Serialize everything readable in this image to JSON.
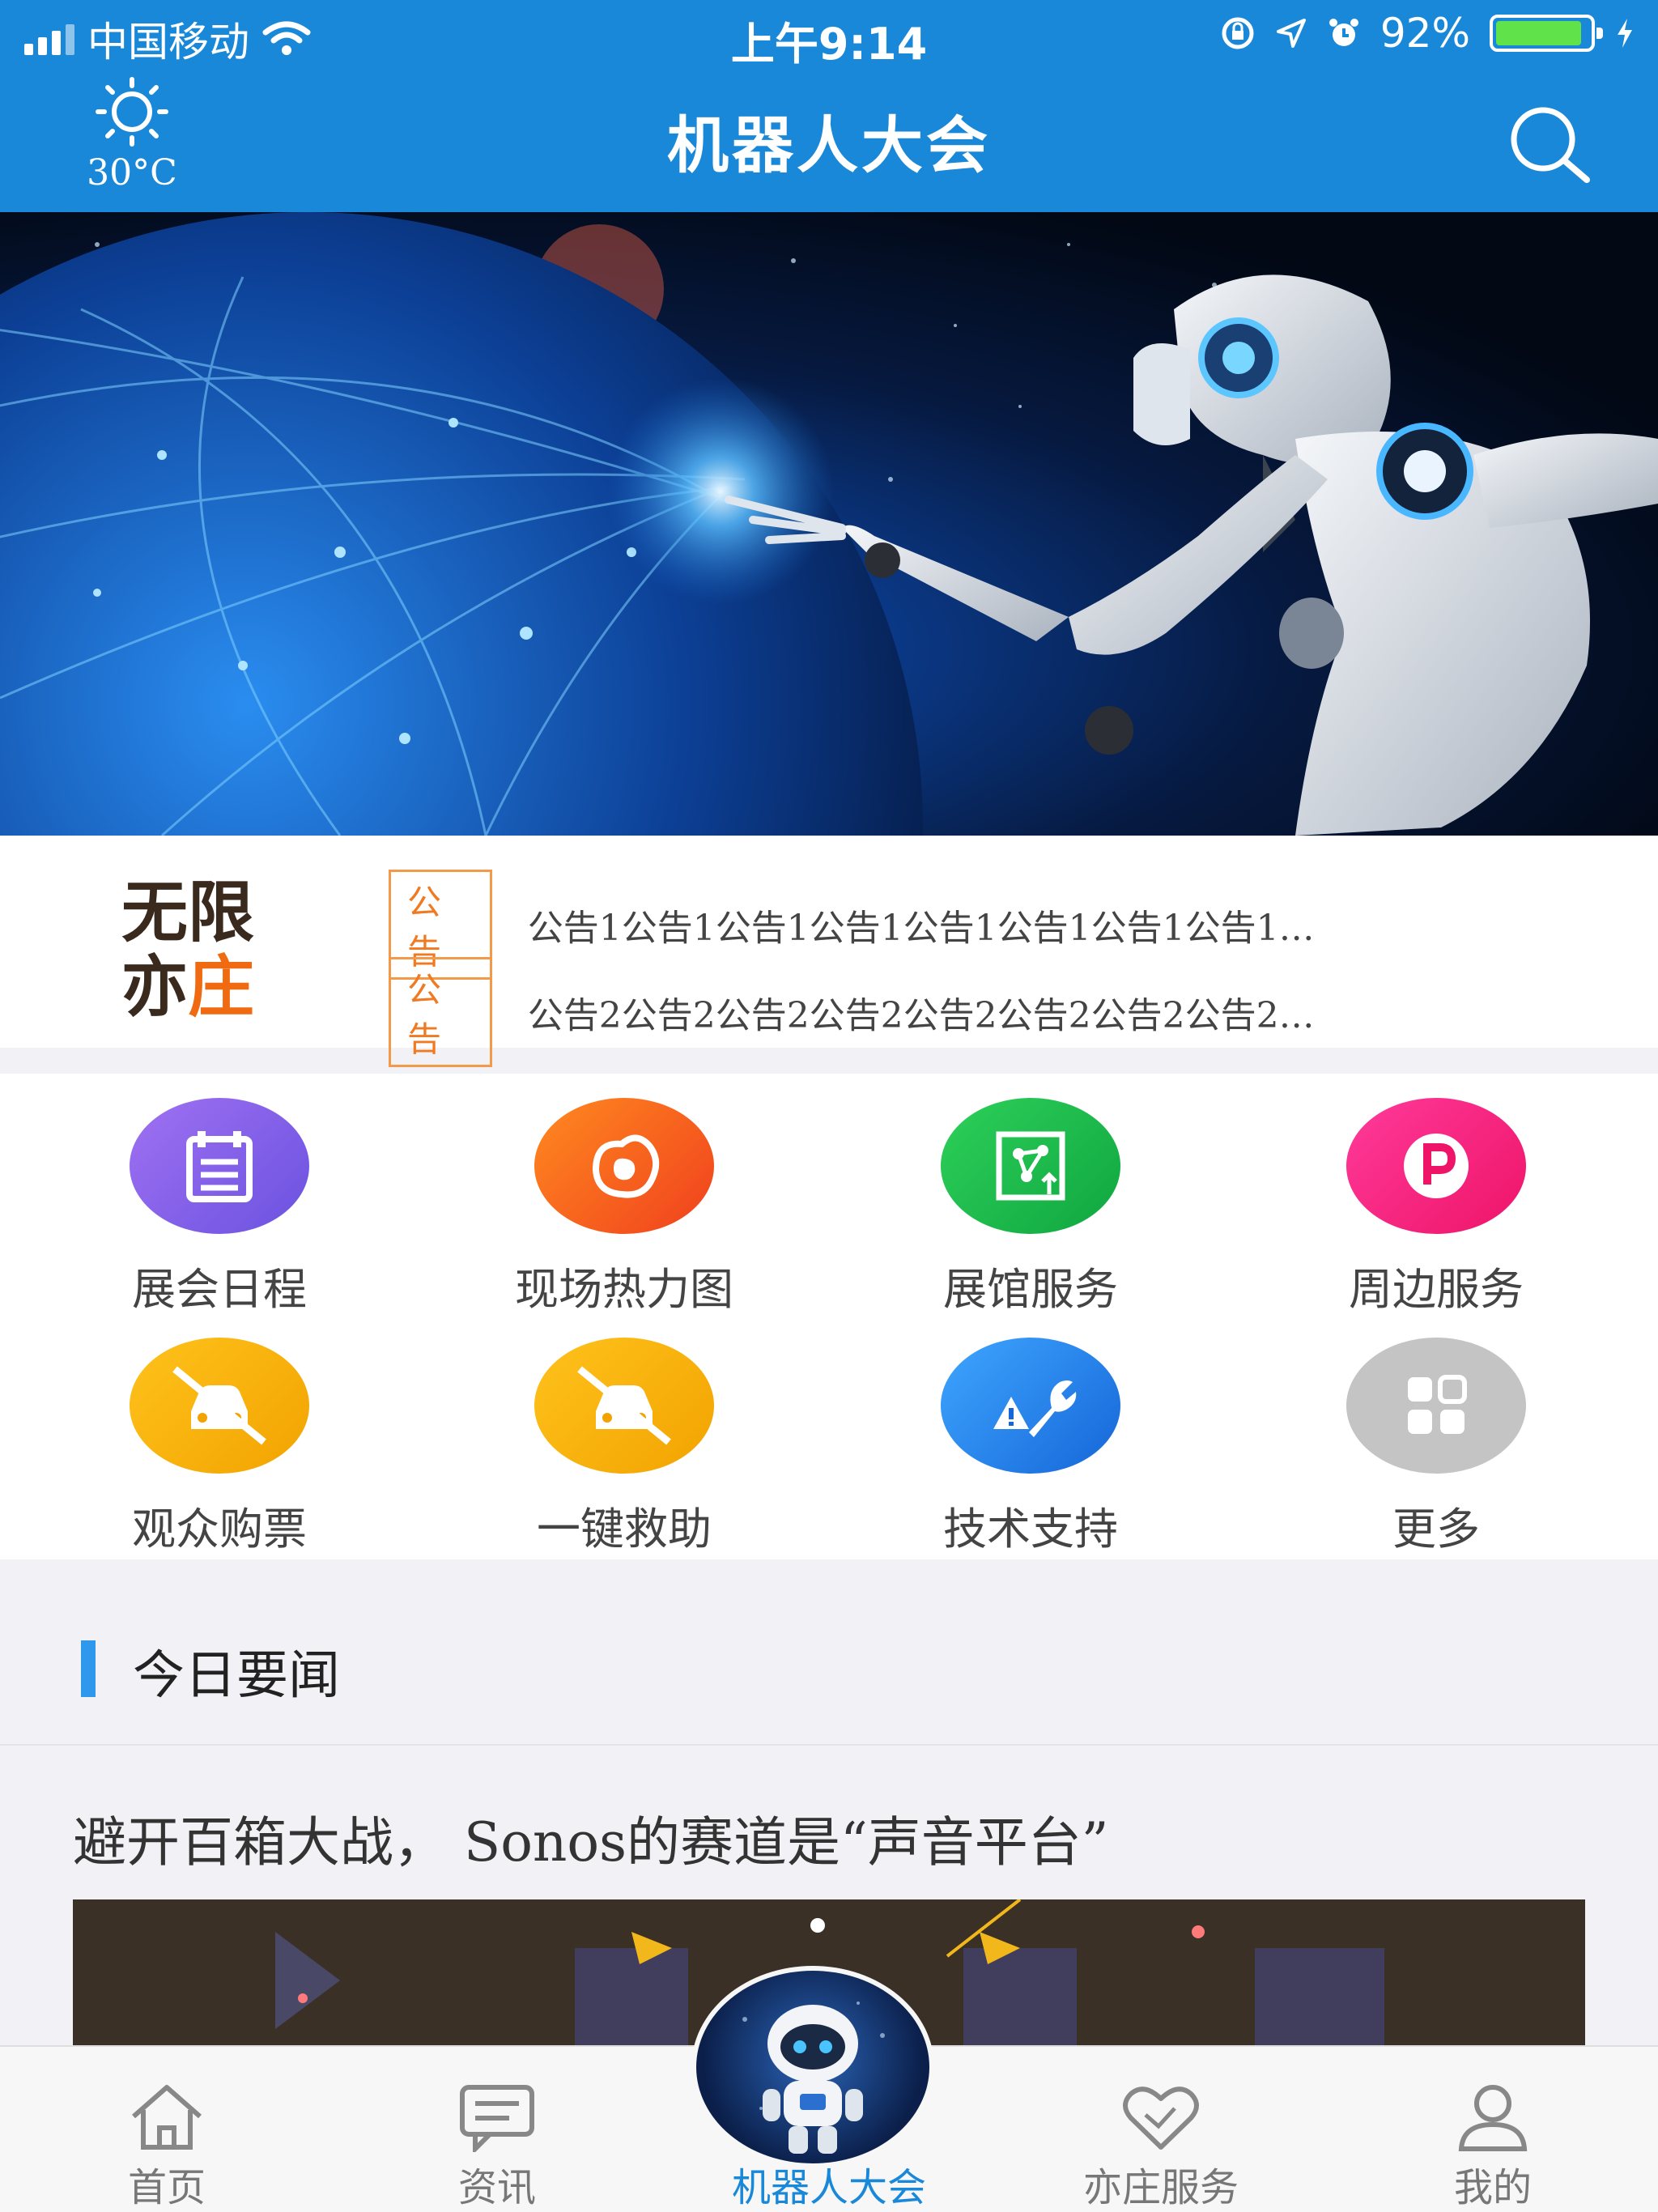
{
  "status_bar": {
    "carrier": "中国移动",
    "time": "上午9:14",
    "battery_percent": "92%",
    "battery_level": 0.92
  },
  "header": {
    "weather_temp": "30°C",
    "title": "机器人大会",
    "search_icon": "search-icon"
  },
  "banner": {
    "image": "robot-touching-globe"
  },
  "notices": {
    "logo_line1_a": "无限",
    "logo_line2_a": "亦",
    "logo_line2_b": "庄",
    "items": [
      {
        "tag": "公告",
        "text": "公告1公告1公告1公告1公告1公告1公告1公告1…"
      },
      {
        "tag": "公告",
        "text": "公告2公告2公告2公告2公告2公告2公告2公告2…"
      }
    ]
  },
  "services": [
    {
      "label": "展会日程",
      "icon": "calendar-icon",
      "color": "#8a63e8"
    },
    {
      "label": "现场热力图",
      "icon": "heatmap-icon",
      "color": "#f2551e"
    },
    {
      "label": "展馆服务",
      "icon": "venue-icon",
      "color": "#16b24a"
    },
    {
      "label": "周边服务",
      "icon": "parking-icon",
      "color": "#f5237f"
    },
    {
      "label": "观众购票",
      "icon": "no-car-icon",
      "color": "#f5b10c"
    },
    {
      "label": "一键救助",
      "icon": "no-car-icon",
      "color": "#f5b10c"
    },
    {
      "label": "技术支持",
      "icon": "wrench-icon",
      "color": "#1f7fe6"
    },
    {
      "label": "更多",
      "icon": "more-grid-icon",
      "color": "#c2c2c2"
    }
  ],
  "news": {
    "section_title": "今日要闻",
    "items": [
      {
        "title": "避开百箱大战， Sonos的赛道是“声音平台”"
      }
    ]
  },
  "tabbar": {
    "items": [
      {
        "label": "首页",
        "icon": "home-icon"
      },
      {
        "label": "资讯",
        "icon": "message-icon"
      },
      {
        "label": "机器人大会",
        "icon": "robot-icon",
        "active": true
      },
      {
        "label": "亦庄服务",
        "icon": "heart-handshake-icon"
      },
      {
        "label": "我的",
        "icon": "user-icon"
      }
    ]
  },
  "colors": {
    "primary": "#1a88d8",
    "accent_orange": "#f07a22"
  }
}
